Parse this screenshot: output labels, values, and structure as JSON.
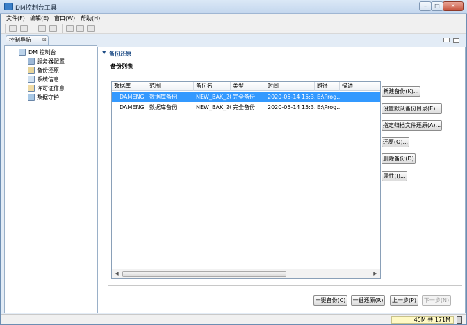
{
  "window": {
    "title": "DM控制台工具",
    "min": "–",
    "max": "□",
    "close": "✕"
  },
  "menu": [
    "文件(F)",
    "编辑(E)",
    "窗口(W)",
    "帮助(H)"
  ],
  "nav": {
    "tab_label": "控制导航",
    "tab_close": "⊠",
    "root": "DM 控制台",
    "items": [
      "服务器配置",
      "备份还原",
      "系统信息",
      "许可证信息",
      "数据守护"
    ]
  },
  "content": {
    "section_arrow": "▼",
    "section_title": "备份还原",
    "subsection_title": "备份列表",
    "table": {
      "columns": [
        "数据库",
        "范围",
        "备份名",
        "类型",
        "时间",
        "路径",
        "描述"
      ],
      "rows": [
        [
          "DAMENG",
          "数据库备份",
          "NEW_BAK_20",
          "完全备份",
          "2020-05-14 15:3...",
          "E:\\Prog...",
          ""
        ],
        [
          "DAMENG",
          "数据库备份",
          "NEW_BAK_20",
          "完全备份",
          "2020-05-14 15:3...",
          "E:\\Prog...",
          ""
        ]
      ],
      "scroll_left": "◀",
      "scroll_right": "▶"
    },
    "side_buttons": [
      "新建备份(K)...",
      "设置默认备份目录(E)...",
      "指定归档文件还原(A)...",
      "还原(O)...",
      "删除备份(D)",
      "属性(I)..."
    ],
    "bottom_buttons": {
      "one_key_backup": "一键备份(C)",
      "one_key_restore": "一键还原(R)",
      "prev": "上一步(P)",
      "next": "下一步(N)"
    }
  },
  "status": {
    "memory": "45M 共 171M"
  },
  "colors": {
    "selection": "#3399ff",
    "header_blue": "#1f4d86"
  }
}
